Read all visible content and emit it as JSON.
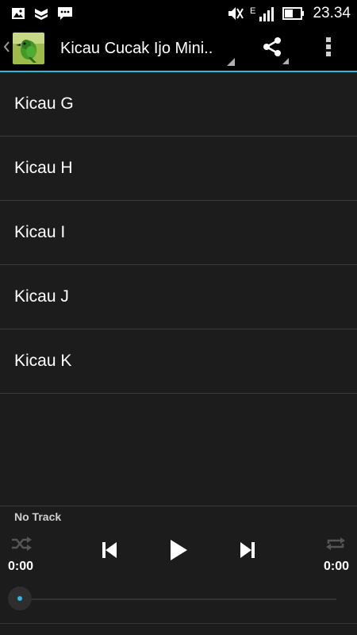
{
  "status_bar": {
    "time": "23.34",
    "icons_left": [
      "image-icon",
      "notification-icon",
      "bbm-icon"
    ],
    "icons_right": [
      "mute-icon",
      "signal-e-icon",
      "battery-icon"
    ],
    "network_label": "E"
  },
  "action_bar": {
    "title": "Kicau Cucak Ijo Mini..",
    "accent_color": "#33b5e5"
  },
  "tracks": [
    {
      "label": "Kicau G"
    },
    {
      "label": "Kicau H"
    },
    {
      "label": "Kicau I"
    },
    {
      "label": "Kicau J"
    },
    {
      "label": "Kicau K"
    }
  ],
  "player": {
    "now_playing": "No Track",
    "elapsed": "0:00",
    "duration": "0:00",
    "progress": 0
  }
}
